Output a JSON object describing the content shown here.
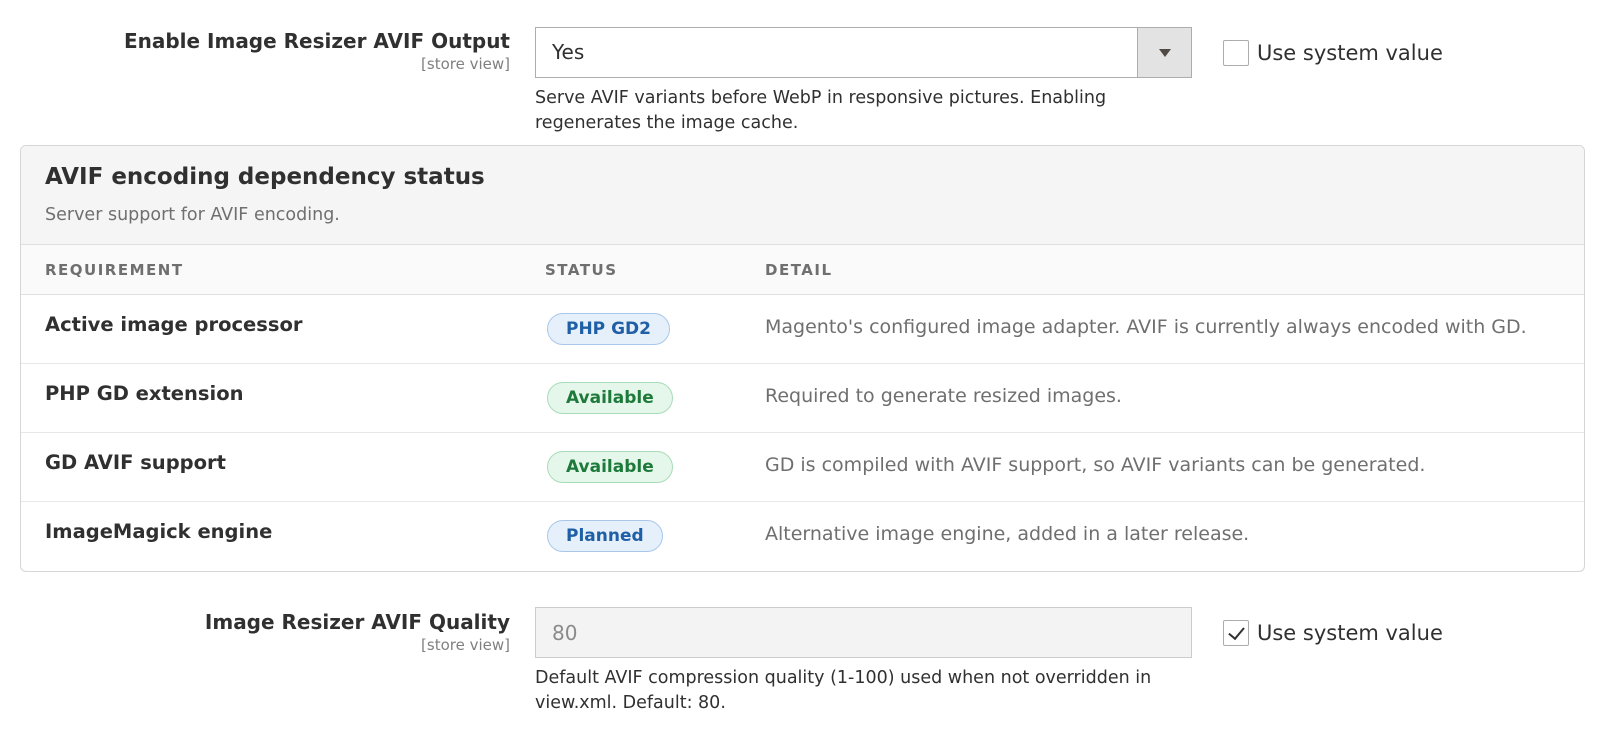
{
  "avif_output": {
    "label": "Enable Image Resizer AVIF Output",
    "scope": "[store view]",
    "selected_value": "Yes",
    "use_system_value_label": "Use system value",
    "use_system_value_checked": false,
    "note": "Serve AVIF variants before WebP in responsive pictures. Enabling regenerates the image cache."
  },
  "status_panel": {
    "title": "AVIF encoding dependency status",
    "description": "Server support for AVIF encoding.",
    "columns": {
      "requirement": "REQUIREMENT",
      "status": "STATUS",
      "detail": "DETAIL"
    },
    "rows": [
      {
        "requirement": "Active image processor",
        "status": "PHP GD2",
        "status_type": "info",
        "detail": "Magento's configured image adapter. AVIF is currently always encoded with GD."
      },
      {
        "requirement": "PHP GD extension",
        "status": "Available",
        "status_type": "success",
        "detail": "Required to generate resized images."
      },
      {
        "requirement": "GD AVIF support",
        "status": "Available",
        "status_type": "success",
        "detail": "GD is compiled with AVIF support, so AVIF variants can be generated."
      },
      {
        "requirement": "ImageMagick engine",
        "status": "Planned",
        "status_type": "info",
        "detail": "Alternative image engine, added in a later release."
      }
    ]
  },
  "avif_quality": {
    "label": "Image Resizer AVIF Quality",
    "scope": "[store view]",
    "value": "80",
    "use_system_value_label": "Use system value",
    "use_system_value_checked": true,
    "note": "Default AVIF compression quality (1-100) used when not overridden in view.xml. Default: 80."
  },
  "colors": {
    "info_badge": "#1f5fa6",
    "success_badge": "#1d7a3a",
    "text": "#303030",
    "muted": "#6f6f6f"
  },
  "icons": {
    "select_arrow": "chevron-down-icon",
    "checkbox_checked": "check-icon"
  }
}
